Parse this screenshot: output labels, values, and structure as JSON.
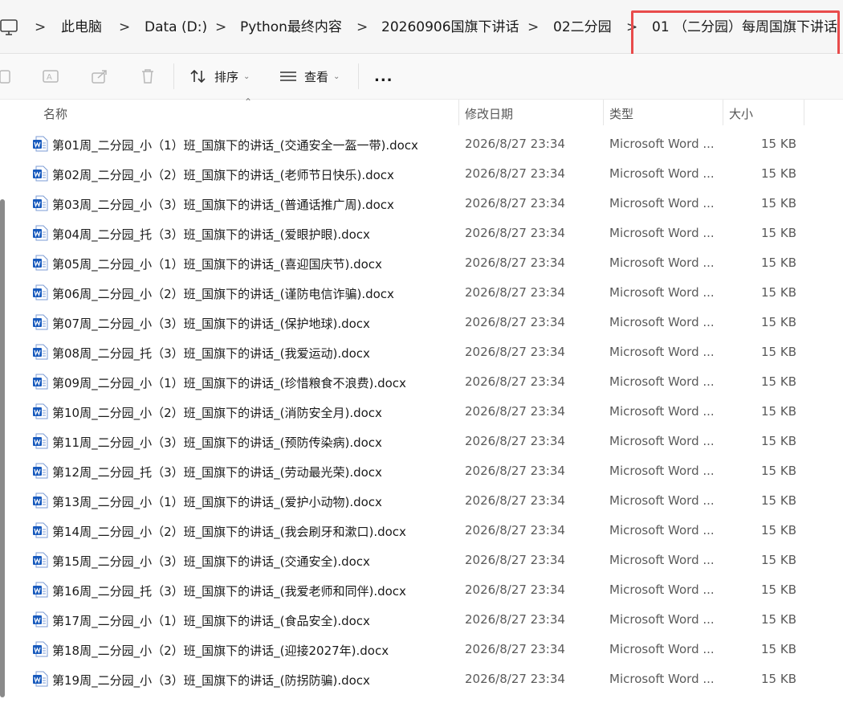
{
  "breadcrumb": {
    "items": [
      "此电脑",
      "Data (D:)",
      "Python最终内容",
      "20260906国旗下讲话",
      "02二分园",
      "01 （二分园）每周国旗下讲话"
    ],
    "separator": ">"
  },
  "toolbar": {
    "sort_label": "排序",
    "view_label": "查看",
    "more_label": "..."
  },
  "columns": {
    "name": "名称",
    "date": "修改日期",
    "type": "类型",
    "size": "大小"
  },
  "files": [
    {
      "name": "第01周_二分园_小（1）班_国旗下的讲话_(交通安全一盔一带).docx",
      "date": "2026/8/27 23:34",
      "type": "Microsoft Word ...",
      "size": "15 KB"
    },
    {
      "name": "第02周_二分园_小（2）班_国旗下的讲话_(老师节日快乐).docx",
      "date": "2026/8/27 23:34",
      "type": "Microsoft Word ...",
      "size": "15 KB"
    },
    {
      "name": "第03周_二分园_小（3）班_国旗下的讲话_(普通话推广周).docx",
      "date": "2026/8/27 23:34",
      "type": "Microsoft Word ...",
      "size": "15 KB"
    },
    {
      "name": "第04周_二分园_托（3）班_国旗下的讲话_(爱眼护眼).docx",
      "date": "2026/8/27 23:34",
      "type": "Microsoft Word ...",
      "size": "15 KB"
    },
    {
      "name": "第05周_二分园_小（1）班_国旗下的讲话_(喜迎国庆节).docx",
      "date": "2026/8/27 23:34",
      "type": "Microsoft Word ...",
      "size": "15 KB"
    },
    {
      "name": "第06周_二分园_小（2）班_国旗下的讲话_(谨防电信诈骗).docx",
      "date": "2026/8/27 23:34",
      "type": "Microsoft Word ...",
      "size": "15 KB"
    },
    {
      "name": "第07周_二分园_小（3）班_国旗下的讲话_(保护地球).docx",
      "date": "2026/8/27 23:34",
      "type": "Microsoft Word ...",
      "size": "15 KB"
    },
    {
      "name": "第08周_二分园_托（3）班_国旗下的讲话_(我爱运动).docx",
      "date": "2026/8/27 23:34",
      "type": "Microsoft Word ...",
      "size": "15 KB"
    },
    {
      "name": "第09周_二分园_小（1）班_国旗下的讲话_(珍惜粮食不浪费).docx",
      "date": "2026/8/27 23:34",
      "type": "Microsoft Word ...",
      "size": "15 KB"
    },
    {
      "name": "第10周_二分园_小（2）班_国旗下的讲话_(消防安全月).docx",
      "date": "2026/8/27 23:34",
      "type": "Microsoft Word ...",
      "size": "15 KB"
    },
    {
      "name": "第11周_二分园_小（3）班_国旗下的讲话_(预防传染病).docx",
      "date": "2026/8/27 23:34",
      "type": "Microsoft Word ...",
      "size": "15 KB"
    },
    {
      "name": "第12周_二分园_托（3）班_国旗下的讲话_(劳动最光荣).docx",
      "date": "2026/8/27 23:34",
      "type": "Microsoft Word ...",
      "size": "15 KB"
    },
    {
      "name": "第13周_二分园_小（1）班_国旗下的讲话_(爱护小动物).docx",
      "date": "2026/8/27 23:34",
      "type": "Microsoft Word ...",
      "size": "15 KB"
    },
    {
      "name": "第14周_二分园_小（2）班_国旗下的讲话_(我会刷牙和漱口).docx",
      "date": "2026/8/27 23:34",
      "type": "Microsoft Word ...",
      "size": "15 KB"
    },
    {
      "name": "第15周_二分园_小（3）班_国旗下的讲话_(交通安全).docx",
      "date": "2026/8/27 23:34",
      "type": "Microsoft Word ...",
      "size": "15 KB"
    },
    {
      "name": "第16周_二分园_托（3）班_国旗下的讲话_(我爱老师和同伴).docx",
      "date": "2026/8/27 23:34",
      "type": "Microsoft Word ...",
      "size": "15 KB"
    },
    {
      "name": "第17周_二分园_小（1）班_国旗下的讲话_(食品安全).docx",
      "date": "2026/8/27 23:34",
      "type": "Microsoft Word ...",
      "size": "15 KB"
    },
    {
      "name": "第18周_二分园_小（2）班_国旗下的讲话_(迎接2027年).docx",
      "date": "2026/8/27 23:34",
      "type": "Microsoft Word ...",
      "size": "15 KB"
    },
    {
      "name": "第19周_二分园_小（3）班_国旗下的讲话_(防拐防骗).docx",
      "date": "2026/8/27 23:34",
      "type": "Microsoft Word ...",
      "size": "15 KB"
    }
  ],
  "colors": {
    "highlight": "#e84b4b",
    "word_blue": "#185abd"
  },
  "icons": {
    "pc": "computer-icon",
    "file": "word-doc-icon"
  }
}
